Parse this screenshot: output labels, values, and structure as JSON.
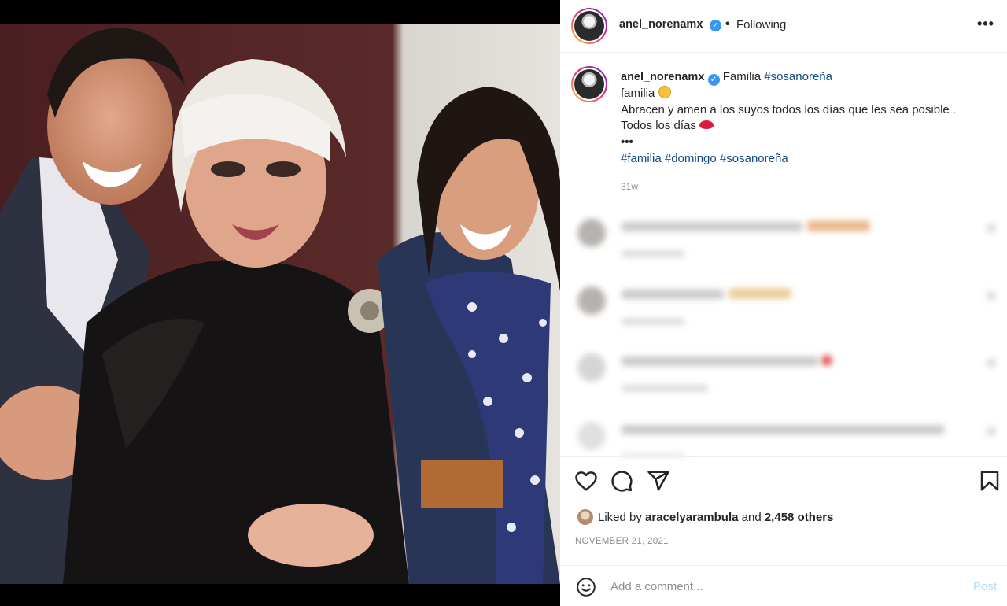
{
  "post": {
    "username": "anel_norenamx",
    "follow_separator": "•",
    "follow_state": "Following",
    "more_icon": "•••"
  },
  "caption": {
    "username": "anel_norenamx",
    "title": "Familia",
    "title_tag": "#sosanoreña",
    "line1": "familia",
    "line2": "Abracen y amen a los suyos todos los días que les sea posible .",
    "line3": "Todos los días",
    "ellipsis": "•••",
    "hashtags": [
      "#familia",
      "#domingo",
      "#sosanoreña"
    ],
    "time": "31w"
  },
  "engagement": {
    "liked_by_prefix": "Liked by",
    "liked_by_user": "aracelyarambula",
    "and": "and",
    "others": "2,458 others",
    "date": "NOVEMBER 21, 2021"
  },
  "comment_box": {
    "placeholder": "Add a comment...",
    "post_label": "Post"
  },
  "icons": {
    "like": "heart-icon",
    "comment": "comment-icon",
    "share": "share-icon",
    "save": "bookmark-icon",
    "emoji": "emoji-icon",
    "verified": "verified-badge-icon"
  },
  "colors": {
    "link": "#00376b",
    "verified": "#3897f0",
    "post_disabled": "#b2dffc",
    "muted": "#8e8e8e"
  }
}
